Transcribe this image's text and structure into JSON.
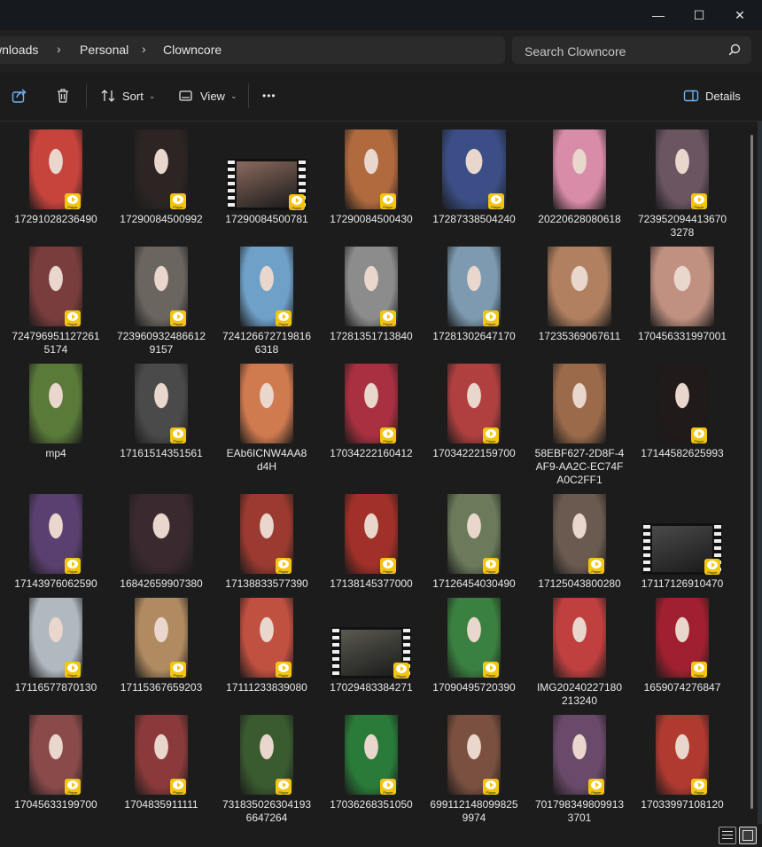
{
  "window": {
    "minimize_label": "—",
    "maximize_label": "☐",
    "close_label": "✕"
  },
  "breadcrumb": [
    "wnloads",
    "Personal",
    "Clowncore"
  ],
  "search": {
    "placeholder": "Search Clowncore"
  },
  "toolbar": {
    "share_icon": "share-icon",
    "delete_icon": "trash-icon",
    "sort_label": "Sort",
    "view_label": "View",
    "more_label": "•••",
    "details_label": "Details"
  },
  "badge_text": "Player",
  "files": [
    {
      "name": "17291028236490",
      "thumb": "portrait",
      "color": "#c7443d",
      "badge": true
    },
    {
      "name": "17290084500992",
      "thumb": "portrait",
      "color": "#2c2523",
      "badge": true
    },
    {
      "name": "17290084500781",
      "thumb": "film",
      "color": "#8b6a5e",
      "badge": true
    },
    {
      "name": "17290084500430",
      "thumb": "portrait",
      "color": "#b06a3e",
      "badge": true
    },
    {
      "name": "17287338504240",
      "thumb": "wide",
      "color": "#3b4f86",
      "badge": true
    },
    {
      "name": "20220628080618",
      "thumb": "portrait",
      "color": "#d98ca8",
      "badge": false
    },
    {
      "name": "723952094413670 3278",
      "thumb": "portrait",
      "color": "#6a5560",
      "badge": true
    },
    {
      "name": "724796951127261 5174",
      "thumb": "portrait",
      "color": "#7a3d3d",
      "badge": true
    },
    {
      "name": "723960932486612 9157",
      "thumb": "portrait",
      "color": "#6b6560",
      "badge": true
    },
    {
      "name": "724126672719816 6318",
      "thumb": "portrait",
      "color": "#6fa0c8",
      "badge": true
    },
    {
      "name": "17281351713840",
      "thumb": "portrait",
      "color": "#8c8c8c",
      "badge": true
    },
    {
      "name": "17281302647170",
      "thumb": "portrait",
      "color": "#7d9ab0",
      "badge": true
    },
    {
      "name": "17235369067611",
      "thumb": "wide",
      "color": "#b08060",
      "badge": false
    },
    {
      "name": "170456331997001",
      "thumb": "wide",
      "color": "#c09080",
      "badge": false
    },
    {
      "name": "mp4",
      "thumb": "portrait",
      "color": "#5a7a3a",
      "badge": false
    },
    {
      "name": "17161514351561",
      "thumb": "portrait",
      "color": "#4a4a4a",
      "badge": true
    },
    {
      "name": "EAb6ICNW4AA8 d4H",
      "thumb": "portrait",
      "color": "#d07a50",
      "badge": false
    },
    {
      "name": "17034222160412",
      "thumb": "portrait",
      "color": "#a83040",
      "badge": true
    },
    {
      "name": "17034222159700",
      "thumb": "portrait",
      "color": "#b04040",
      "badge": true
    },
    {
      "name": "58EBF627-2D8F-4 AF9-AA2C-EC74F A0C2FF1",
      "thumb": "portrait",
      "color": "#9a6a4a",
      "badge": false
    },
    {
      "name": "17144582625993",
      "thumb": "portrait",
      "color": "#201a1a",
      "badge": true
    },
    {
      "name": "17143976062590",
      "thumb": "portrait",
      "color": "#5a4070",
      "badge": true
    },
    {
      "name": "16842659907380",
      "thumb": "wide",
      "color": "#3a2a30",
      "badge": false
    },
    {
      "name": "17138833577390",
      "thumb": "portrait",
      "color": "#9a3a30",
      "badge": true
    },
    {
      "name": "17138145377000",
      "thumb": "portrait",
      "color": "#a03028",
      "badge": true
    },
    {
      "name": "17126454030490",
      "thumb": "portrait",
      "color": "#6a7a5a",
      "badge": true
    },
    {
      "name": "17125043800280",
      "thumb": "portrait",
      "color": "#6a5a50",
      "badge": true
    },
    {
      "name": "17117126910470",
      "thumb": "film",
      "color": "#4a4a4a",
      "badge": true
    },
    {
      "name": "17116577870130",
      "thumb": "portrait",
      "color": "#b0b8c0",
      "badge": true
    },
    {
      "name": "17115367659203",
      "thumb": "portrait",
      "color": "#b08a60",
      "badge": true
    },
    {
      "name": "17111233839080",
      "thumb": "portrait",
      "color": "#c05040",
      "badge": true
    },
    {
      "name": "17029483384271",
      "thumb": "film",
      "color": "#5a5a50",
      "badge": true
    },
    {
      "name": "17090495720390",
      "thumb": "portrait",
      "color": "#3a8040",
      "badge": true
    },
    {
      "name": "IMG20240227180 213240",
      "thumb": "portrait",
      "color": "#c04040",
      "badge": false
    },
    {
      "name": "1659074276847",
      "thumb": "portrait",
      "color": "#a02030",
      "badge": true
    },
    {
      "name": "17045633199700",
      "thumb": "portrait",
      "color": "#8a4a4a",
      "badge": true
    },
    {
      "name": "1704835911111",
      "thumb": "portrait",
      "color": "#8a3a3a",
      "badge": true
    },
    {
      "name": "731835026304193 6647264",
      "thumb": "portrait",
      "color": "#3a5a30",
      "badge": true
    },
    {
      "name": "17036268351050",
      "thumb": "portrait",
      "color": "#2a7a3a",
      "badge": true
    },
    {
      "name": "699112148099825 9974",
      "thumb": "portrait",
      "color": "#7a5040",
      "badge": true
    },
    {
      "name": "701798349809913 3701",
      "thumb": "portrait",
      "color": "#6a4a6a",
      "badge": true
    },
    {
      "name": "17033997108120",
      "thumb": "portrait",
      "color": "#b03a30",
      "badge": true
    }
  ],
  "status": {
    "details_view_icon": "list-view-icon",
    "thumbnail_view_icon": "thumbnail-view-icon"
  }
}
